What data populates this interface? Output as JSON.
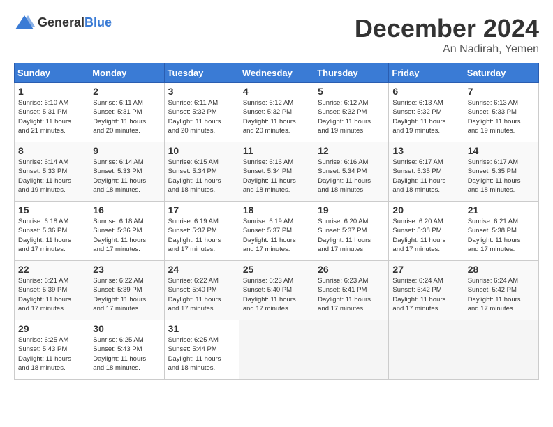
{
  "logo": {
    "general": "General",
    "blue": "Blue"
  },
  "header": {
    "month": "December 2024",
    "location": "An Nadirah, Yemen"
  },
  "weekdays": [
    "Sunday",
    "Monday",
    "Tuesday",
    "Wednesday",
    "Thursday",
    "Friday",
    "Saturday"
  ],
  "weeks": [
    [
      {
        "day": "1",
        "info": "Sunrise: 6:10 AM\nSunset: 5:31 PM\nDaylight: 11 hours\nand 21 minutes."
      },
      {
        "day": "2",
        "info": "Sunrise: 6:11 AM\nSunset: 5:31 PM\nDaylight: 11 hours\nand 20 minutes."
      },
      {
        "day": "3",
        "info": "Sunrise: 6:11 AM\nSunset: 5:32 PM\nDaylight: 11 hours\nand 20 minutes."
      },
      {
        "day": "4",
        "info": "Sunrise: 6:12 AM\nSunset: 5:32 PM\nDaylight: 11 hours\nand 20 minutes."
      },
      {
        "day": "5",
        "info": "Sunrise: 6:12 AM\nSunset: 5:32 PM\nDaylight: 11 hours\nand 19 minutes."
      },
      {
        "day": "6",
        "info": "Sunrise: 6:13 AM\nSunset: 5:32 PM\nDaylight: 11 hours\nand 19 minutes."
      },
      {
        "day": "7",
        "info": "Sunrise: 6:13 AM\nSunset: 5:33 PM\nDaylight: 11 hours\nand 19 minutes."
      }
    ],
    [
      {
        "day": "8",
        "info": "Sunrise: 6:14 AM\nSunset: 5:33 PM\nDaylight: 11 hours\nand 19 minutes."
      },
      {
        "day": "9",
        "info": "Sunrise: 6:14 AM\nSunset: 5:33 PM\nDaylight: 11 hours\nand 18 minutes."
      },
      {
        "day": "10",
        "info": "Sunrise: 6:15 AM\nSunset: 5:34 PM\nDaylight: 11 hours\nand 18 minutes."
      },
      {
        "day": "11",
        "info": "Sunrise: 6:16 AM\nSunset: 5:34 PM\nDaylight: 11 hours\nand 18 minutes."
      },
      {
        "day": "12",
        "info": "Sunrise: 6:16 AM\nSunset: 5:34 PM\nDaylight: 11 hours\nand 18 minutes."
      },
      {
        "day": "13",
        "info": "Sunrise: 6:17 AM\nSunset: 5:35 PM\nDaylight: 11 hours\nand 18 minutes."
      },
      {
        "day": "14",
        "info": "Sunrise: 6:17 AM\nSunset: 5:35 PM\nDaylight: 11 hours\nand 18 minutes."
      }
    ],
    [
      {
        "day": "15",
        "info": "Sunrise: 6:18 AM\nSunset: 5:36 PM\nDaylight: 11 hours\nand 17 minutes."
      },
      {
        "day": "16",
        "info": "Sunrise: 6:18 AM\nSunset: 5:36 PM\nDaylight: 11 hours\nand 17 minutes."
      },
      {
        "day": "17",
        "info": "Sunrise: 6:19 AM\nSunset: 5:37 PM\nDaylight: 11 hours\nand 17 minutes."
      },
      {
        "day": "18",
        "info": "Sunrise: 6:19 AM\nSunset: 5:37 PM\nDaylight: 11 hours\nand 17 minutes."
      },
      {
        "day": "19",
        "info": "Sunrise: 6:20 AM\nSunset: 5:37 PM\nDaylight: 11 hours\nand 17 minutes."
      },
      {
        "day": "20",
        "info": "Sunrise: 6:20 AM\nSunset: 5:38 PM\nDaylight: 11 hours\nand 17 minutes."
      },
      {
        "day": "21",
        "info": "Sunrise: 6:21 AM\nSunset: 5:38 PM\nDaylight: 11 hours\nand 17 minutes."
      }
    ],
    [
      {
        "day": "22",
        "info": "Sunrise: 6:21 AM\nSunset: 5:39 PM\nDaylight: 11 hours\nand 17 minutes."
      },
      {
        "day": "23",
        "info": "Sunrise: 6:22 AM\nSunset: 5:39 PM\nDaylight: 11 hours\nand 17 minutes."
      },
      {
        "day": "24",
        "info": "Sunrise: 6:22 AM\nSunset: 5:40 PM\nDaylight: 11 hours\nand 17 minutes."
      },
      {
        "day": "25",
        "info": "Sunrise: 6:23 AM\nSunset: 5:40 PM\nDaylight: 11 hours\nand 17 minutes."
      },
      {
        "day": "26",
        "info": "Sunrise: 6:23 AM\nSunset: 5:41 PM\nDaylight: 11 hours\nand 17 minutes."
      },
      {
        "day": "27",
        "info": "Sunrise: 6:24 AM\nSunset: 5:42 PM\nDaylight: 11 hours\nand 17 minutes."
      },
      {
        "day": "28",
        "info": "Sunrise: 6:24 AM\nSunset: 5:42 PM\nDaylight: 11 hours\nand 17 minutes."
      }
    ],
    [
      {
        "day": "29",
        "info": "Sunrise: 6:25 AM\nSunset: 5:43 PM\nDaylight: 11 hours\nand 18 minutes."
      },
      {
        "day": "30",
        "info": "Sunrise: 6:25 AM\nSunset: 5:43 PM\nDaylight: 11 hours\nand 18 minutes."
      },
      {
        "day": "31",
        "info": "Sunrise: 6:25 AM\nSunset: 5:44 PM\nDaylight: 11 hours\nand 18 minutes."
      },
      {
        "day": "",
        "info": ""
      },
      {
        "day": "",
        "info": ""
      },
      {
        "day": "",
        "info": ""
      },
      {
        "day": "",
        "info": ""
      }
    ]
  ]
}
